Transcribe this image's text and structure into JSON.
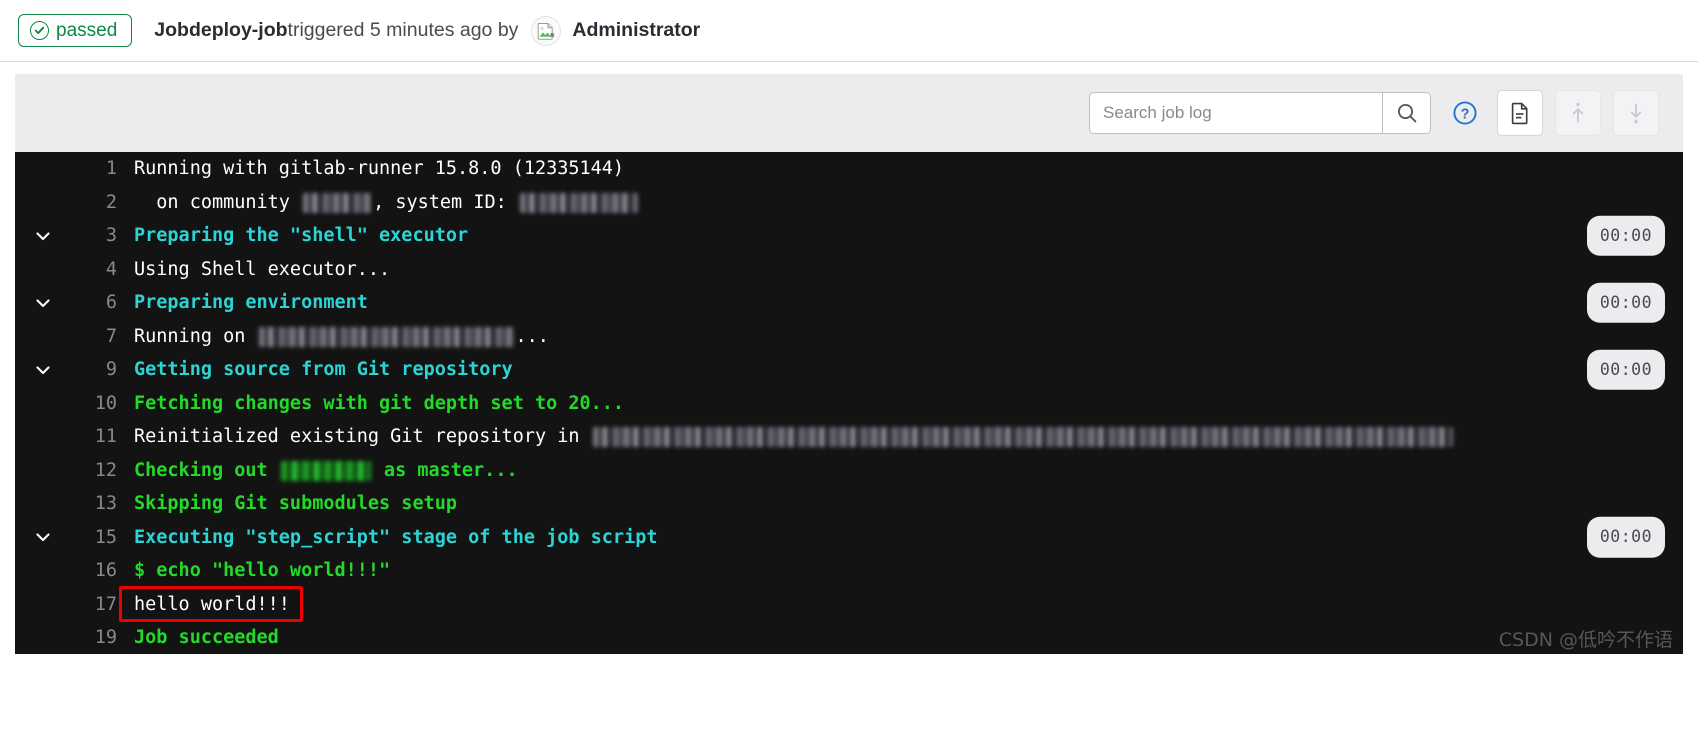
{
  "header": {
    "status_label": "passed",
    "status_color": "#108548",
    "job_prefix": "Job ",
    "job_name": "deploy-job",
    "triggered_text": " triggered 5 minutes ago by ",
    "user_name": "Administrator",
    "avatar_icon": "broken-image-icon"
  },
  "toolbar": {
    "search_placeholder": "Search job log",
    "search_value": "",
    "search_icon": "search-icon",
    "help_icon": "question-circle-icon",
    "raw_icon": "document-icon",
    "scroll_top_icon": "arrow-up-icon",
    "scroll_bottom_icon": "arrow-down-icon"
  },
  "log": {
    "background": "#131313",
    "section_color": "#2dd4d4",
    "output_color": "#23d929",
    "plain_color": "#ffffff",
    "lines": [
      {
        "no": "1",
        "collapsible": false,
        "color": "plain",
        "text": "Running with gitlab-runner 15.8.0 (12335144)",
        "time": ""
      },
      {
        "no": "2",
        "collapsible": false,
        "color": "plain",
        "text": "  on community ",
        "redactions": [
          68,
          118
        ],
        "suffix": ", system ID: ",
        "time": ""
      },
      {
        "no": "3",
        "collapsible": true,
        "color": "section",
        "text": "Preparing the \"shell\" executor",
        "time": "00:00"
      },
      {
        "no": "4",
        "collapsible": false,
        "color": "plain",
        "text": "Using Shell executor...",
        "time": ""
      },
      {
        "no": "6",
        "collapsible": true,
        "color": "section",
        "text": "Preparing environment",
        "time": "00:00"
      },
      {
        "no": "7",
        "collapsible": false,
        "color": "plain",
        "text": "Running on ",
        "redactions": [
          255
        ],
        "suffix": "...",
        "time": ""
      },
      {
        "no": "9",
        "collapsible": true,
        "color": "section",
        "text": "Getting source from Git repository",
        "time": "00:00"
      },
      {
        "no": "10",
        "collapsible": false,
        "color": "output",
        "text": "Fetching changes with git depth set to 20...",
        "time": ""
      },
      {
        "no": "11",
        "collapsible": false,
        "color": "plain",
        "text": "Reinitialized existing Git repository in ",
        "redactions": [
          860
        ],
        "suffix": "",
        "time": ""
      },
      {
        "no": "12",
        "collapsible": false,
        "color": "output",
        "text": "Checking out ",
        "redactions": [
          90
        ],
        "suffix": " as master...",
        "time": ""
      },
      {
        "no": "13",
        "collapsible": false,
        "color": "output",
        "text": "Skipping Git submodules setup",
        "time": ""
      },
      {
        "no": "15",
        "collapsible": true,
        "color": "section",
        "text": "Executing \"step_script\" stage of the job script",
        "time": "00:00"
      },
      {
        "no": "16",
        "collapsible": false,
        "color": "output",
        "text": "$ echo \"hello world!!!\"",
        "time": ""
      },
      {
        "no": "17",
        "collapsible": false,
        "color": "plain",
        "text": "hello world!!!",
        "time": "",
        "highlighted": true
      },
      {
        "no": "19",
        "collapsible": false,
        "color": "output",
        "text": "Job succeeded",
        "time": ""
      }
    ]
  },
  "watermark": "CSDN @低吟不作语"
}
